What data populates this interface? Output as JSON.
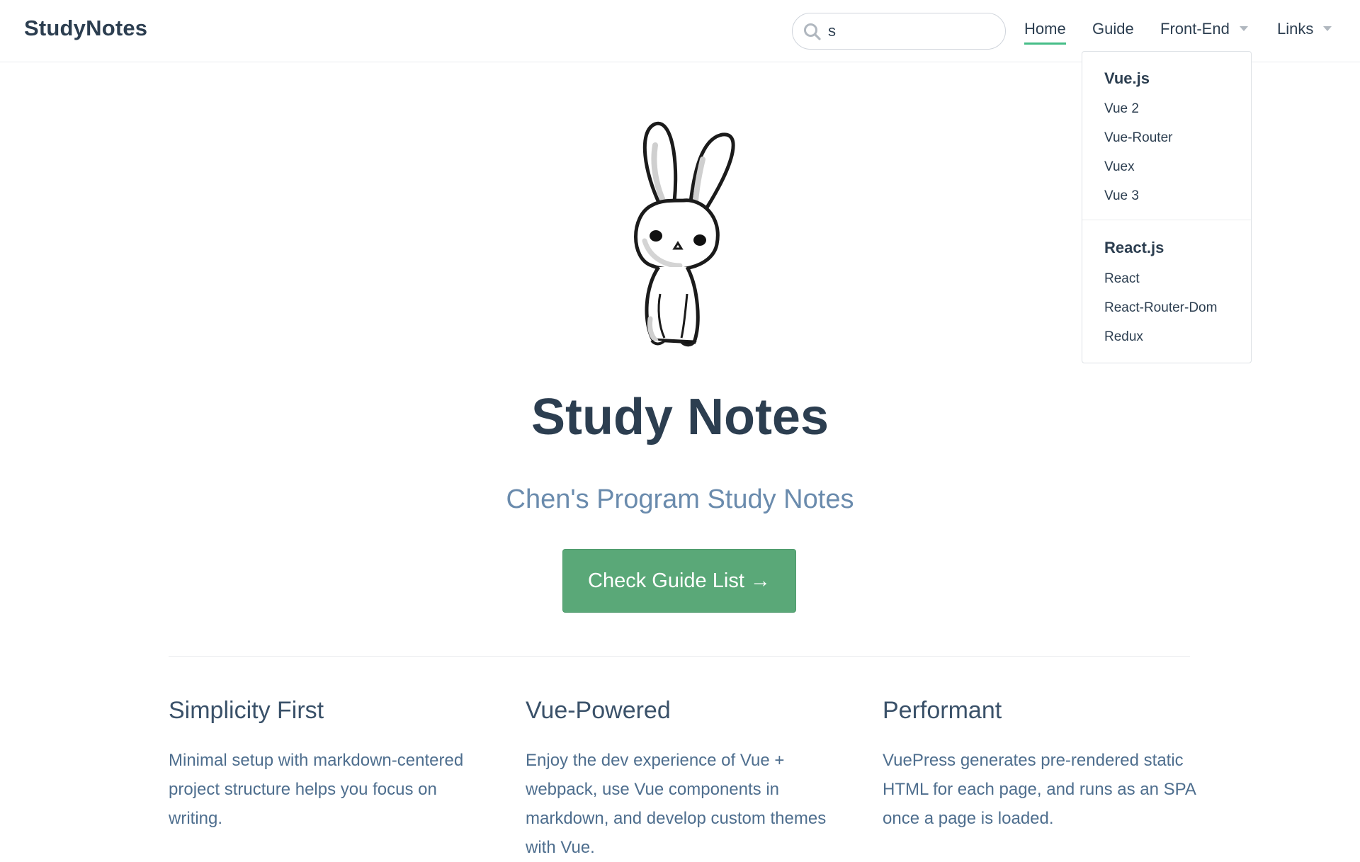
{
  "navbar": {
    "site_name": "StudyNotes",
    "search": {
      "value": "s",
      "placeholder": ""
    },
    "links": {
      "home": "Home",
      "guide": "Guide",
      "frontend": "Front-End",
      "links": "Links"
    },
    "active_link": "Home"
  },
  "dropdown": {
    "groups": [
      {
        "title": "Vue.js",
        "items": [
          "Vue 2",
          "Vue-Router",
          "Vuex",
          "Vue 3"
        ]
      },
      {
        "title": "React.js",
        "items": [
          "React",
          "React-Router-Dom",
          "Redux"
        ]
      }
    ]
  },
  "hero": {
    "title": "Study Notes",
    "description": "Chen's Program Study Notes",
    "action_label": "Check Guide List →"
  },
  "features": [
    {
      "title": "Simplicity First",
      "details": "Minimal setup with markdown-centered project structure helps you focus on writing."
    },
    {
      "title": "Vue-Powered",
      "details": "Enjoy the dev experience of Vue + webpack, use Vue components in markdown, and develop custom themes with Vue."
    },
    {
      "title": "Performant",
      "details": "VuePress generates pre-rendered static HTML for each page, and runs as an SPA once a page is loaded."
    }
  ],
  "colors": {
    "accent": "#46bd87",
    "button": "#5aa878",
    "text": "#2c3e50",
    "description": "#6a8bad"
  },
  "icons": [
    "search-icon",
    "chevron-down-icon",
    "bunny-illustration"
  ]
}
